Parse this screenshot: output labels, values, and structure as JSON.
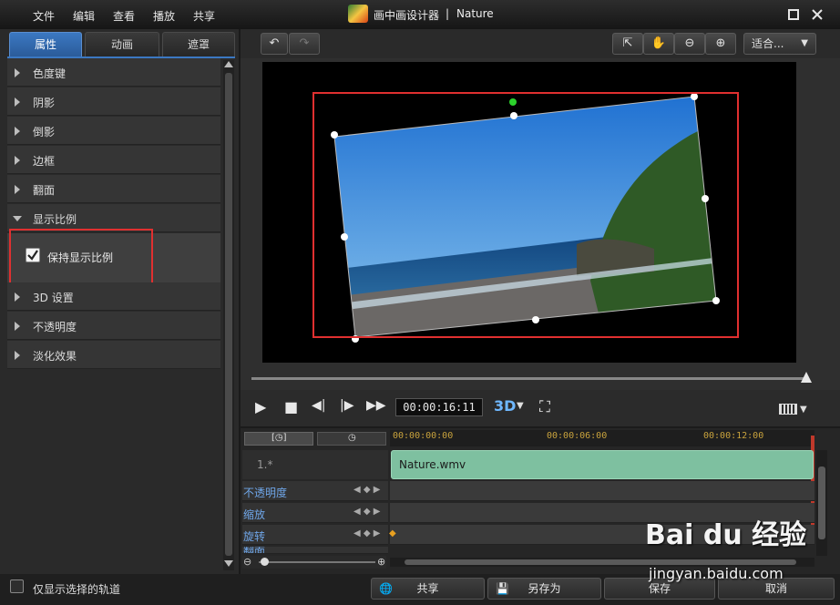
{
  "menu": {
    "items": [
      "文件",
      "编辑",
      "查看",
      "播放",
      "共享"
    ]
  },
  "window": {
    "title": "画中画设计器",
    "separator": "|",
    "file": "Nature"
  },
  "tabs": [
    {
      "label": "属性",
      "active": true
    },
    {
      "label": "动画",
      "active": false
    },
    {
      "label": "遮罩",
      "active": false
    }
  ],
  "properties": [
    {
      "label": "色度键",
      "expanded": false
    },
    {
      "label": "阴影",
      "expanded": false
    },
    {
      "label": "倒影",
      "expanded": false
    },
    {
      "label": "边框",
      "expanded": false
    },
    {
      "label": "翻面",
      "expanded": false
    },
    {
      "label": "显示比例",
      "expanded": true
    },
    {
      "label": "3D 设置",
      "expanded": false
    },
    {
      "label": "不透明度",
      "expanded": false
    },
    {
      "label": "淡化效果",
      "expanded": false
    }
  ],
  "aspect_option": {
    "label": "保持显示比例",
    "checked": true
  },
  "toolbar": {
    "fit_label": "适合..."
  },
  "playback": {
    "timecode": "00:00:16:11",
    "mode_3d": "3D"
  },
  "timeline": {
    "ruler_ticks": [
      "00:00:00:00",
      "00:00:06:00",
      "00:00:12:00"
    ],
    "track_name": "1.*",
    "clip_name": "Nature.wmv",
    "keyframe_tracks": [
      "不透明度",
      "缩放",
      "旋转",
      "翻面"
    ]
  },
  "bottom": {
    "only_selected_label": "仅显示选择的轨道",
    "share_label": "共享",
    "save_as_label": "另存为",
    "save_label": "保存",
    "cancel_label": "取消"
  },
  "watermark": {
    "logo": "Bai du 经验",
    "url": "jingyan.baidu.com"
  },
  "colors": {
    "accent": "#3b78c2",
    "highlight": "#e03030",
    "clip": "#7ec0a0",
    "timecode_ruler": "#c9a33d",
    "track_label": "#6fa6e8"
  }
}
